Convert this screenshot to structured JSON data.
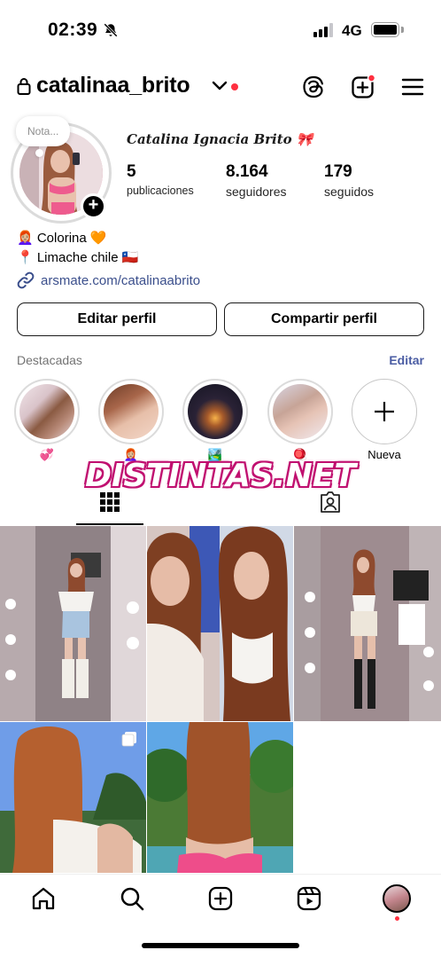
{
  "status_bar": {
    "time": "02:39",
    "network": "4G"
  },
  "header": {
    "username": "catalinaa_brito"
  },
  "profile": {
    "note_placeholder": "Nota...",
    "display_name": "Catalina Ignacia Brito 🎀",
    "stats": [
      {
        "value": "5",
        "label": "publicaciones"
      },
      {
        "value": "8.164",
        "label": "seguidores"
      },
      {
        "value": "179",
        "label": "seguidos"
      }
    ],
    "bio": [
      "👩🏼‍🦰 Colorina 🧡",
      "📍 Limache chile 🇨🇱"
    ],
    "link": "arsmate.com/catalinaabrito"
  },
  "buttons": {
    "edit": "Editar perfil",
    "share": "Compartir perfil"
  },
  "highlights": {
    "title": "Destacadas",
    "edit": "Editar",
    "items": [
      {
        "label": "💞"
      },
      {
        "label": "👩🏼‍🦰"
      },
      {
        "label": "🏞️"
      },
      {
        "label": "🪀"
      },
      {
        "label": "Nueva"
      }
    ]
  },
  "watermark": "DISTINTAS.NET",
  "icons": {
    "header": [
      "lock-icon",
      "chevron-down-icon",
      "threads-icon",
      "create-icon",
      "menu-icon"
    ],
    "tabs": [
      "grid-icon",
      "tagged-icon"
    ],
    "nav": [
      "home-icon",
      "search-icon",
      "create-icon",
      "reels-icon",
      "profile-avatar"
    ]
  },
  "colors": {
    "notification_red": "#ff3040",
    "link_blue": "#3b4f8c",
    "watermark_pink": "#c01070"
  }
}
